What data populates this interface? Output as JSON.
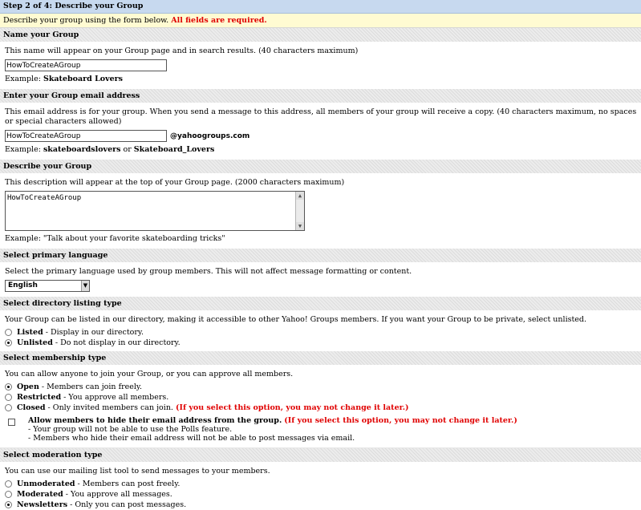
{
  "step": {
    "title": "Step 2 of 4: Describe your Group"
  },
  "intro": {
    "text": "Describe your group using the form below.",
    "required": "All fields are required."
  },
  "name_section": {
    "heading": "Name your Group",
    "description": "This name will appear on your Group page and in search results. (40 characters maximum)",
    "value": "HowToCreateAGroup",
    "example_prefix": "Example:",
    "example_value": "Skateboard Lovers"
  },
  "email_section": {
    "heading": "Enter your Group email address",
    "description": "This email address is for your group. When you send a message to this address, all members of your group will receive a copy. (40 characters maximum, no spaces or special characters allowed)",
    "value": "HowToCreateAGroup",
    "domain": "@yahoogroups.com",
    "example_prefix": "Example:",
    "example_value1": "skateboardslovers",
    "example_or": "or",
    "example_value2": "Skateboard_Lovers"
  },
  "describe_section": {
    "heading": "Describe your Group",
    "description": "This description will appear at the top of your Group page. (2000 characters maximum)",
    "value": "HowToCreateAGroup",
    "example": "Example: \"Talk about your favorite skateboarding tricks\""
  },
  "language_section": {
    "heading": "Select primary language",
    "description": "Select the primary language used by group members. This will not affect message formatting or content.",
    "selected": "English"
  },
  "directory_section": {
    "heading": "Select directory listing type",
    "description": "Your Group can be listed in our directory, making it accessible to other Yahoo! Groups members. If you want your Group to be private, select unlisted.",
    "options": [
      {
        "label": "Listed",
        "detail": "- Display in our directory.",
        "selected": false
      },
      {
        "label": "Unlisted",
        "detail": "- Do not display in our directory.",
        "selected": true
      }
    ]
  },
  "membership_section": {
    "heading": "Select membership type",
    "description": "You can allow anyone to join your Group, or you can approve all members.",
    "options": [
      {
        "label": "Open",
        "detail": "- Members can join freely.",
        "selected": true,
        "warning": ""
      },
      {
        "label": "Restricted",
        "detail": "- You approve all members.",
        "selected": false,
        "warning": ""
      },
      {
        "label": "Closed",
        "detail": "- Only invited members can join.",
        "selected": false,
        "warning": "(If you select this option, you may not change it later.)"
      }
    ],
    "hide_email": {
      "label": "Allow members to hide their email address from the group.",
      "warning": "(If you select this option, you may not change it later.)",
      "note1": "- Your group will not be able to use the Polls feature.",
      "note2": "- Members who hide their email address will not be able to post messages via email.",
      "checked": false
    }
  },
  "moderation_section": {
    "heading": "Select moderation type",
    "description": "You can use our mailing list tool to send messages to your members.",
    "options": [
      {
        "label": "Unmoderated",
        "detail": "- Members can post freely.",
        "selected": false
      },
      {
        "label": "Moderated",
        "detail": "- You approve all messages.",
        "selected": false
      },
      {
        "label": "Newsletters",
        "detail": "- Only you can post messages.",
        "selected": true
      }
    ]
  }
}
